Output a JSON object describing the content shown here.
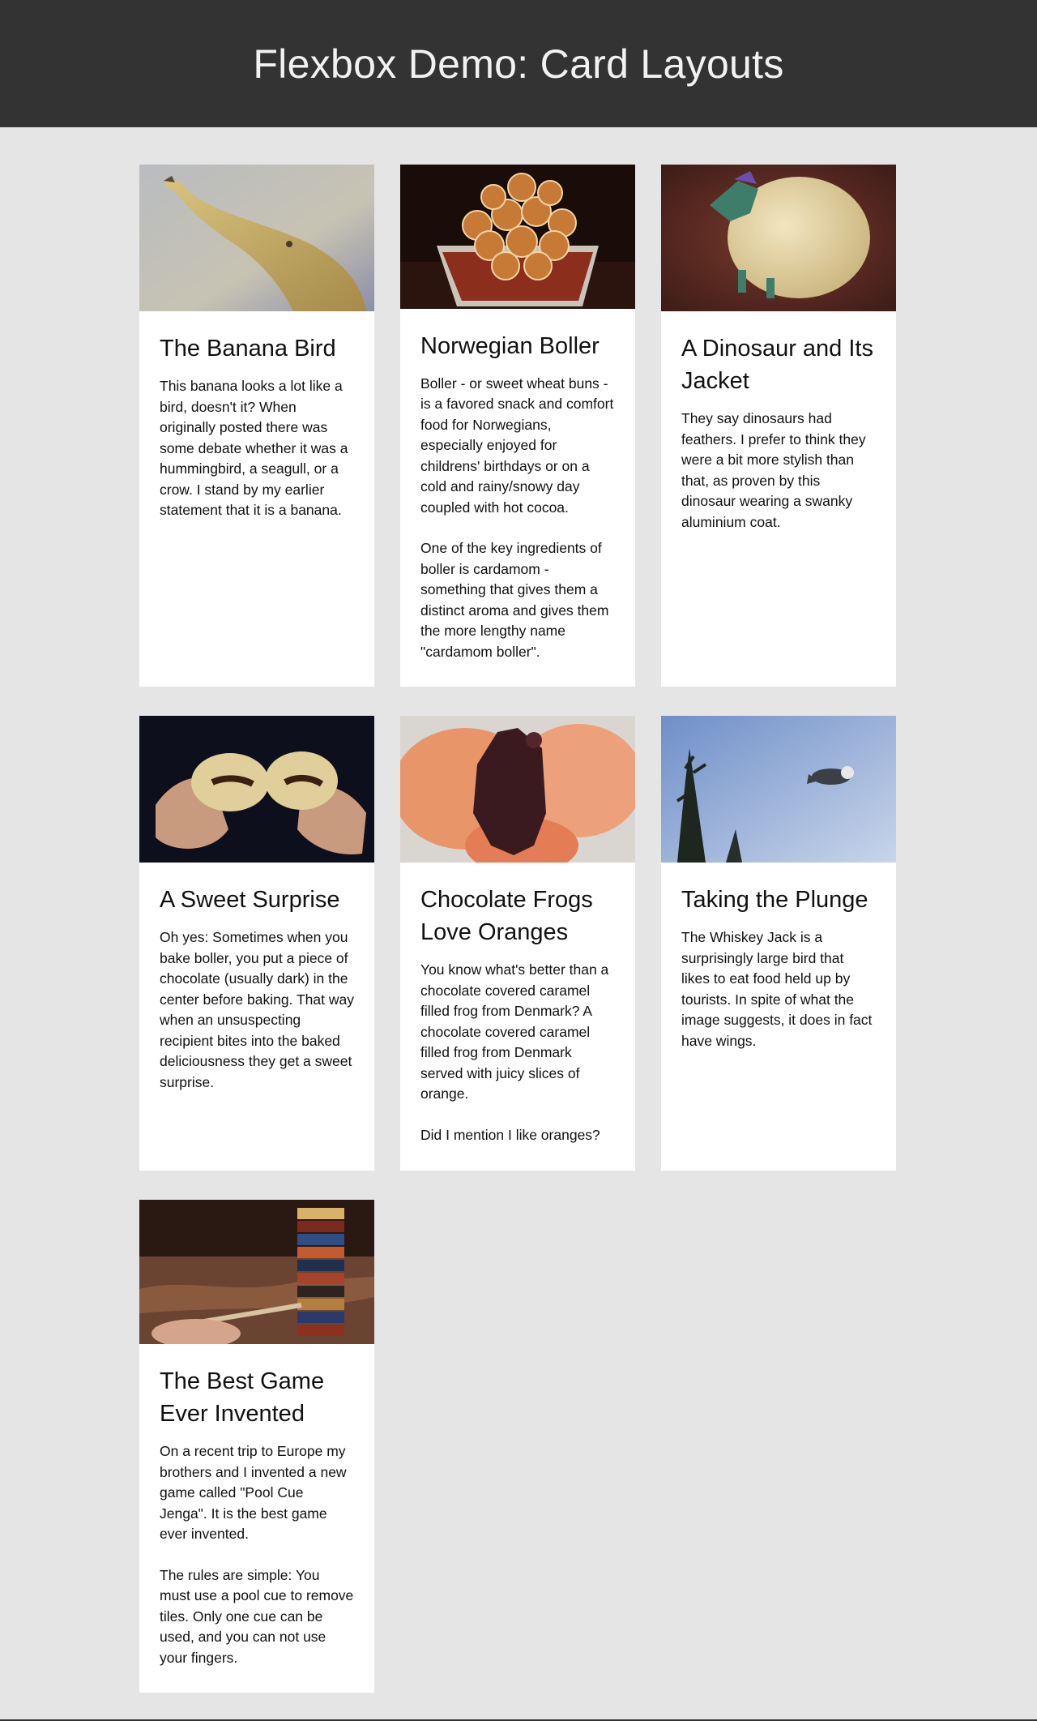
{
  "header": {
    "title": "Flexbox Demo: Card Layouts"
  },
  "cards": [
    {
      "title": "The Banana Bird",
      "image": "banana-bird-photo",
      "paragraphs": [
        "This banana looks a lot like a bird, doesn't it? When originally posted there was some debate whether it was a hummingbird, a seagull, or a crow. I stand by my earlier statement that it is a banana."
      ]
    },
    {
      "title": "Norwegian Boller",
      "image": "boller-buns-photo",
      "paragraphs": [
        "Boller - or sweet wheat buns - is a favored snack and comfort food for Norwegians, especially enjoyed for childrens' birthdays or on a cold and rainy/snowy day coupled with hot cocoa.",
        "One of the key ingredients of boller is cardamom - something that gives them a distinct aroma and gives them the more lengthy name \"cardamom boller\"."
      ]
    },
    {
      "title": "A Dinosaur and Its Jacket",
      "image": "dinosaur-foil-photo",
      "paragraphs": [
        "They say dinosaurs had feathers. I prefer to think they were a bit more stylish than that, as proven by this dinosaur wearing a swanky aluminium coat."
      ]
    },
    {
      "title": "A Sweet Surprise",
      "image": "chocolate-bun-photo",
      "paragraphs": [
        "Oh yes: Sometimes when you bake boller, you put a piece of chocolate (usually dark) in the center before baking. That way when an unsuspecting recipient bites into the baked deliciousness they get a sweet surprise."
      ]
    },
    {
      "title": "Chocolate Frogs Love Oranges",
      "image": "chocolate-frog-photo",
      "paragraphs": [
        "You know what's better than a chocolate covered caramel filled frog from Denmark? A chocolate covered caramel filled frog from Denmark served with juicy slices of orange.",
        "Did I mention I like oranges?"
      ]
    },
    {
      "title": "Taking the Plunge",
      "image": "whiskey-jack-photo",
      "paragraphs": [
        "The Whiskey Jack is a surprisingly large bird that likes to eat food held up by tourists. In spite of what the image suggests, it does in fact have wings."
      ]
    },
    {
      "title": "The Best Game Ever Invented",
      "image": "pool-cue-jenga-photo",
      "paragraphs": [
        "On a recent trip to Europe my brothers and I invented a new game called \"Pool Cue Jenga\". It is the best game ever invented.",
        "The rules are simple: You must use a pool cue to remove tiles. Only one cue can be used, and you can not use your fingers."
      ]
    }
  ]
}
